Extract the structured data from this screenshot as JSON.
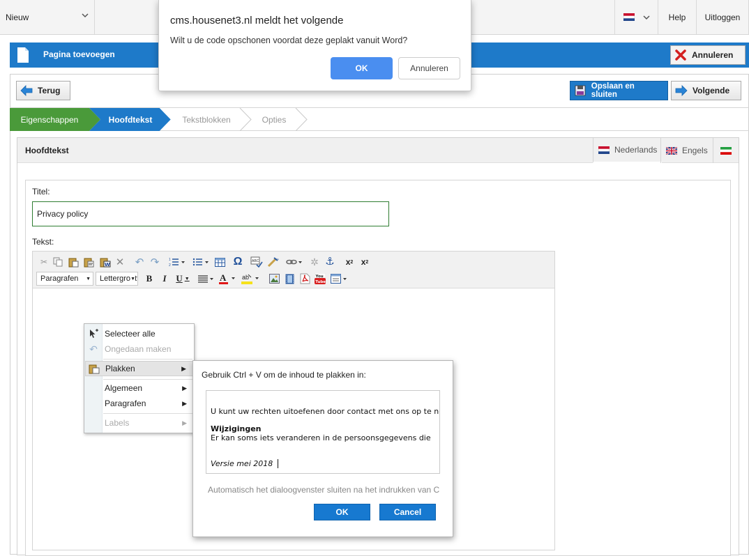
{
  "topbar": {
    "new_label": "Nieuw",
    "help_label": "Help",
    "logout_label": "Uitloggen"
  },
  "page_header": {
    "title": "Pagina toevoegen",
    "cancel_label": "Annuleren"
  },
  "actions": {
    "back_label": "Terug",
    "save_close_label": "Opslaan en sluiten",
    "next_label": "Volgende"
  },
  "steps": [
    {
      "label": "Eigenschappen",
      "state": "done"
    },
    {
      "label": "Hoofdtekst",
      "state": "active"
    },
    {
      "label": "Tekstblokken",
      "state": "pending"
    },
    {
      "label": "Opties",
      "state": "pending"
    }
  ],
  "content": {
    "heading": "Hoofdtekst",
    "languages": [
      "Nederlands",
      "Engels"
    ]
  },
  "form": {
    "title_label": "Titel:",
    "title_value": "Privacy policy",
    "text_label": "Tekst:"
  },
  "editor": {
    "paragraph_select": "Paragrafen",
    "font_select": "Lettergrootte"
  },
  "context_menu": {
    "items": [
      {
        "label": "Selecteer alle",
        "enabled": true
      },
      {
        "label": "Ongedaan maken",
        "enabled": false
      },
      {
        "label": "Plakken",
        "enabled": true,
        "submenu": true
      },
      {
        "label": "Algemeen",
        "enabled": true,
        "submenu": true
      },
      {
        "label": "Paragrafen",
        "enabled": true,
        "submenu": true
      },
      {
        "label": "Labels",
        "enabled": false,
        "submenu": true
      }
    ]
  },
  "paste_dialog": {
    "instruction": "Gebruik Ctrl + V om de inhoud te plakken in:",
    "line1": "U kunt uw rechten uitoefenen door contact met ons op te nemen.",
    "heading": "Wijzigingen",
    "line2": "Er kan soms iets veranderen in de persoonsgegevens die",
    "version": "Versie mei 2018",
    "auto_close": "Automatisch het dialoogvenster sluiten na het indrukken van Ctrl + V",
    "ok_label": "OK",
    "cancel_label": "Cancel"
  },
  "alert": {
    "title": "cms.housenet3.nl meldt het volgende",
    "message": "Wilt u de code opschonen voordat deze geplakt vanuit Word?",
    "ok_label": "OK",
    "cancel_label": "Annuleren"
  },
  "colors": {
    "brand_blue": "#1e7ac9",
    "step_done": "#4a9a3a",
    "step_active": "#1e7ac9",
    "alert_ok": "#4a8ef0",
    "dialog_button": "#1779d0"
  }
}
